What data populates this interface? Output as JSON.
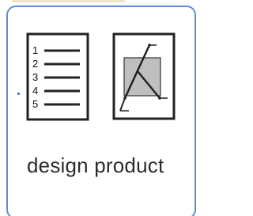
{
  "tile": {
    "label": "design product",
    "accent_color": "#5b8fd4",
    "icons": [
      {
        "name": "numbered-list-icon",
        "numbers": [
          "1",
          "2",
          "3",
          "4",
          "5"
        ]
      },
      {
        "name": "diagram-document-icon"
      }
    ]
  }
}
